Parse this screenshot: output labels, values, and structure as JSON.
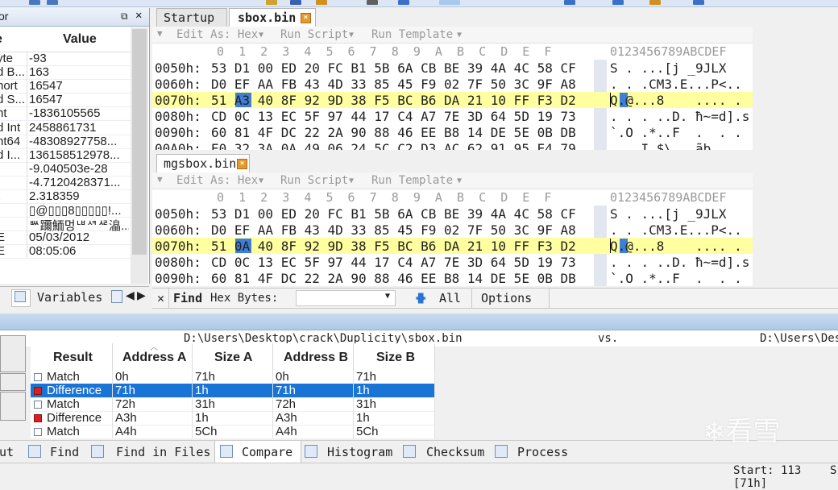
{
  "inspector": {
    "title": "or",
    "col_name": "e",
    "col_value": "Value",
    "rows": [
      {
        "name": "yte",
        "value": "-93"
      },
      {
        "name": "d B...",
        "value": "163"
      },
      {
        "name": "hort",
        "value": "16547"
      },
      {
        "name": "d S...",
        "value": "16547"
      },
      {
        "name": "nt",
        "value": "-1836105565"
      },
      {
        "name": "d Int",
        "value": "2458861731"
      },
      {
        "name": "nt64",
        "value": "-48308927758..."
      },
      {
        "name": "d I...",
        "value": "136158512978..."
      },
      {
        "name": "",
        "value": "-9.040503e-28"
      },
      {
        "name": "",
        "value": "-4.7120428371..."
      },
      {
        "name": "t",
        "value": "2.318359"
      },
      {
        "name": "",
        "value": "▯@▯▯▯8▯▯▯▯▯!..."
      },
      {
        "name": "",
        "value": "ᄥ躎鮞멍ᄖᄸᄰ㵿..."
      },
      {
        "name": "E",
        "value": "05/03/2012"
      },
      {
        "name": "E",
        "value": "08:05:06"
      }
    ]
  },
  "left_tabs": {
    "variables": "Variables"
  },
  "doc_tabs": [
    {
      "label": "Startup"
    },
    {
      "label": "sbox.bin"
    }
  ],
  "toolbar2": {
    "edit_as": "Edit As: Hex",
    "run_script": "Run Script",
    "run_template": "Run Template"
  },
  "column_header": {
    "nibbles": "0  1  2  3  4  5  6  7  8  9  A  B  C  D  E  F",
    "ascii": "0123456789ABCDEF"
  },
  "pane1": {
    "rows": [
      {
        "addr": "0050h:",
        "bytes": "53 D1 00 ED 20 FC B1 5B 6A CB BE 39 4A 4C 58 CF",
        "ascii": "S . ...[j _9JLX"
      },
      {
        "addr": "0060h:",
        "bytes": "D0 EF AA FB 43 4D 33 85 45 F9 02 7F 50 3C 9F A8",
        "ascii": ". . .CM3.E...P<.."
      },
      {
        "addr": "0070h:",
        "bytes": "51 A3 40 8F 92 9D 38 F5 BC B6 DA 21 10 FF F3 D2",
        "ascii": "Q.@...8    .... ."
      },
      {
        "addr": "0080h:",
        "bytes": "CD 0C 13 EC 5F 97 44 17 C4 A7 7E 3D 64 5D 19 73",
        "ascii": ". . . ..D. ħ~=d].s"
      },
      {
        "addr": "0090h:",
        "bytes": "60 81 4F DC 22 2A 90 88 46 EE B8 14 DE 5E 0B DB",
        "ascii": "`.O .*..F  .  . ."
      },
      {
        "addr": "00A0h:",
        "bytes": "E0 32 3A 0A 49 06 24 5C C2 D3 AC 62 91 95 E4 79",
        "ascii": "  . I $\\. .ãb"
      }
    ]
  },
  "pane2": {
    "tab": "mgsbox.bin",
    "rows": [
      {
        "addr": "0050h:",
        "bytes": "53 D1 00 ED 20 FC B1 5B 6A CB BE 39 4A 4C 58 CF",
        "ascii": "S . ...[j _9JLX"
      },
      {
        "addr": "0060h:",
        "bytes": "D0 EF AA FB 43 4D 33 85 45 F9 02 7F 50 3C 9F A8",
        "ascii": ". . .CM3.E...P<.."
      },
      {
        "addr": "0070h:",
        "bytes": "51 0A 40 8F 92 9D 38 F5 BC B6 DA 21 10 FF F3 D2",
        "ascii": "Q.@...8    .... ."
      },
      {
        "addr": "0080h:",
        "bytes": "CD 0C 13 EC 5F 97 44 17 C4 A7 7E 3D 64 5D 19 73",
        "ascii": ". . . ..D. ħ~=d].s"
      },
      {
        "addr": "0090h:",
        "bytes": "60 81 4F DC 22 2A 90 88 46 EE B8 14 DE 5E 0B DB",
        "ascii": "`.O .*..F  .  . ."
      }
    ]
  },
  "findbar": {
    "find": "Find",
    "hex_bytes": "Hex Bytes:",
    "all": "All",
    "options": "Options"
  },
  "compare": {
    "path_a": "D:\\Users\\Desktop\\crack\\Duplicity\\sbox.bin",
    "vs": "vs.",
    "path_b": "D:\\Users\\Des",
    "headers": [
      "Result",
      "Address A",
      "Size A",
      "Address B",
      "Size B"
    ],
    "rows": [
      {
        "result": "Match",
        "addr_a": "0h",
        "size_a": "71h",
        "addr_b": "0h",
        "size_b": "71h",
        "kind": "match"
      },
      {
        "result": "Difference",
        "addr_a": "71h",
        "size_a": "1h",
        "addr_b": "71h",
        "size_b": "1h",
        "kind": "diff"
      },
      {
        "result": "Match",
        "addr_a": "72h",
        "size_a": "31h",
        "addr_b": "72h",
        "size_b": "31h",
        "kind": "match"
      },
      {
        "result": "Difference",
        "addr_a": "A3h",
        "size_a": "1h",
        "addr_b": "A3h",
        "size_b": "1h",
        "kind": "diff"
      },
      {
        "result": "Match",
        "addr_a": "A4h",
        "size_a": "5Ch",
        "addr_b": "A4h",
        "size_b": "5Ch",
        "kind": "match"
      }
    ]
  },
  "bottom_tabs": [
    {
      "label": "ut"
    },
    {
      "label": "Find"
    },
    {
      "label": "Find in Files"
    },
    {
      "label": "Compare"
    },
    {
      "label": "Histogram"
    },
    {
      "label": "Checksum"
    },
    {
      "label": "Process"
    }
  ],
  "status": {
    "left": "Start: 113 [71h]",
    "right": "S"
  },
  "watermark": "看雪",
  "colors": {
    "highlight_row": "#ffffa0",
    "selection": "#3d7fd6",
    "diff_marker": "#d92020",
    "selected_row": "#1a74d6"
  }
}
